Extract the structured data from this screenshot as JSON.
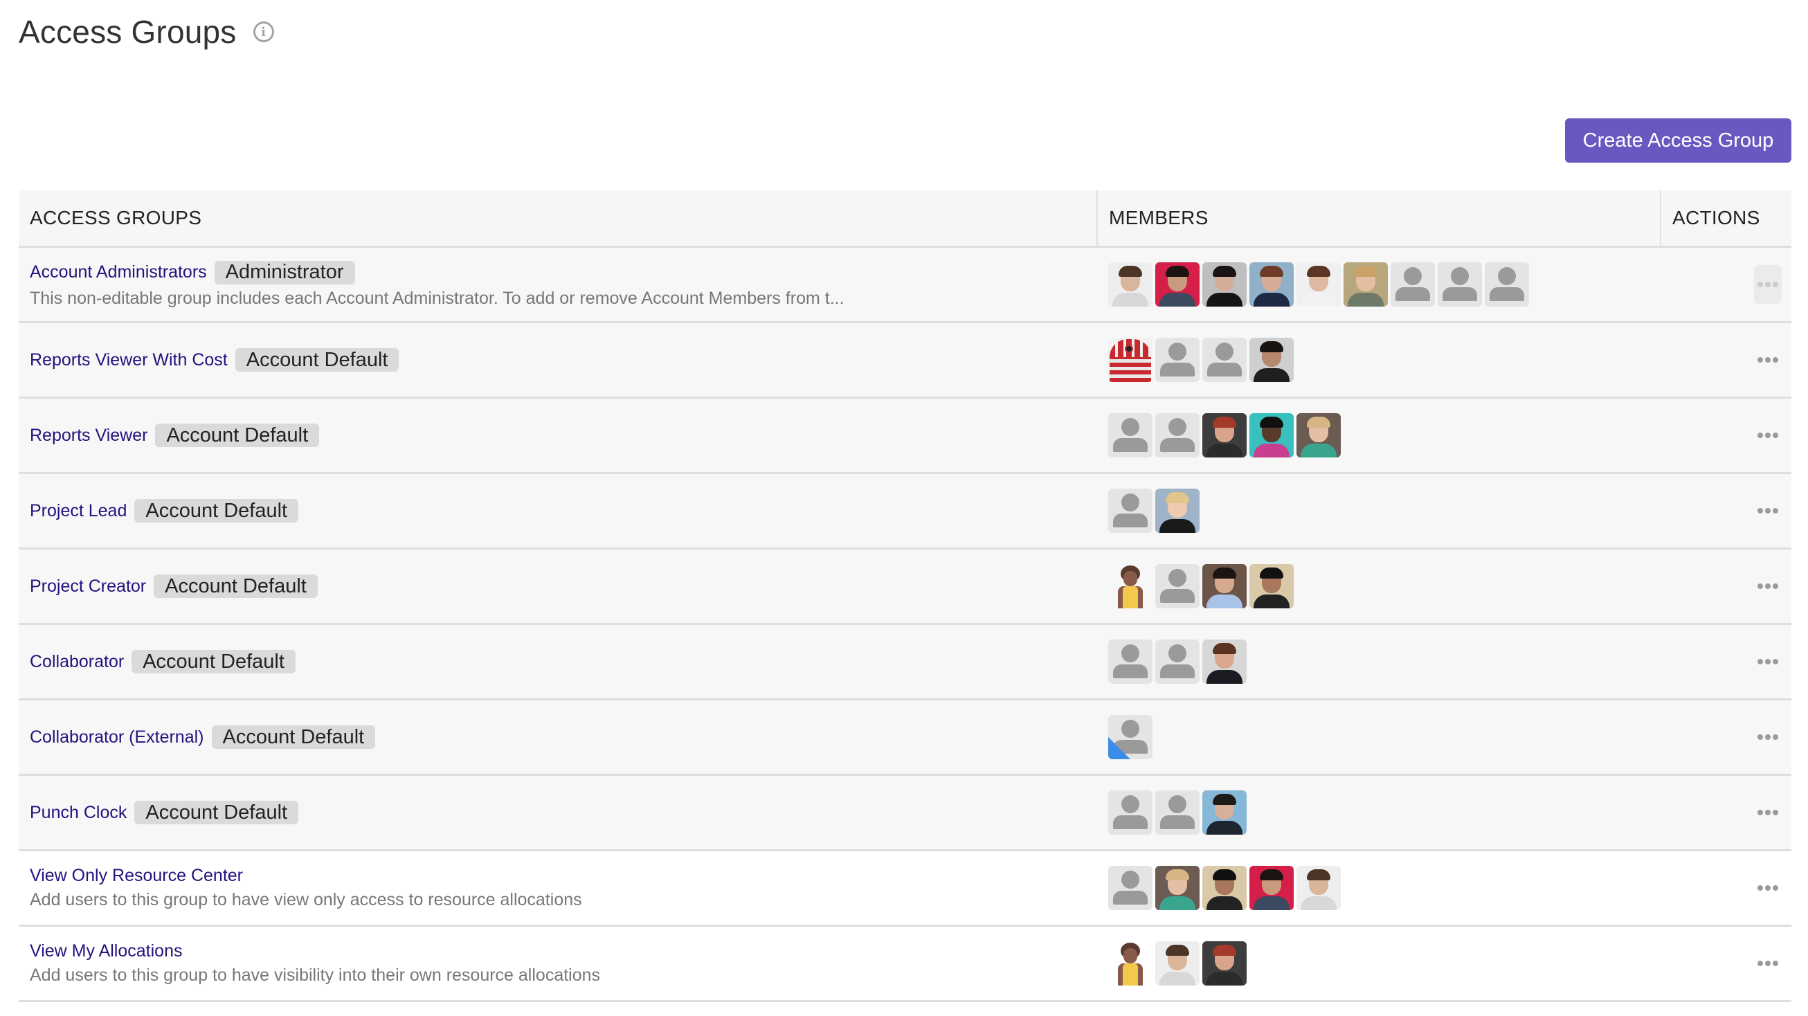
{
  "header": {
    "title": "Access Groups",
    "info_icon": "info-circle-icon"
  },
  "toolbar": {
    "create_label": "Create Access Group",
    "accent_color": "#6b57c0"
  },
  "table": {
    "columns": [
      "ACCESS GROUPS",
      "MEMBERS",
      "ACTIONS"
    ],
    "rows": [
      {
        "name": "Account Administrators",
        "badge": "Administrator",
        "description": "This non-editable group includes each Account Administrator. To add or remove Account Members from t...",
        "shaded": true,
        "actions_disabled": true,
        "members": [
          {
            "type": "photo",
            "skin": "#d9b59a",
            "hair": "#4a3526",
            "top": "#d8d8d8",
            "bg": "#eeeeee"
          },
          {
            "type": "photo",
            "skin": "#c99a7d",
            "hair": "#1d1412",
            "top": "#3b4a5e",
            "bg": "#d51e48"
          },
          {
            "type": "photo",
            "skin": "#d4ad98",
            "hair": "#1a1414",
            "top": "#151515",
            "bg": "#bfbfbf"
          },
          {
            "type": "photo",
            "skin": "#d8ab96",
            "hair": "#6e3b26",
            "top": "#1e2a44",
            "bg": "#8fb0c8"
          },
          {
            "type": "photo",
            "skin": "#e0b8a2",
            "hair": "#5b3624",
            "top": "#f2f2f2",
            "bg": "#f0f0f0"
          },
          {
            "type": "photo",
            "skin": "#e3bea0",
            "hair": "#c9a26a",
            "top": "#6d7a68",
            "bg": "#b8a77c"
          },
          {
            "type": "placeholder"
          },
          {
            "type": "placeholder"
          },
          {
            "type": "placeholder"
          }
        ]
      },
      {
        "name": "Reports Viewer With Cost",
        "badge": "Account Default",
        "description": "",
        "shaded": true,
        "actions_disabled": false,
        "members": [
          {
            "type": "robot"
          },
          {
            "type": "placeholder"
          },
          {
            "type": "placeholder"
          },
          {
            "type": "photo",
            "skin": "#b5876c",
            "hair": "#1a1410",
            "top": "#1f1f1f",
            "bg": "#cfcfcf"
          }
        ]
      },
      {
        "name": "Reports Viewer",
        "badge": "Account Default",
        "description": "",
        "shaded": true,
        "actions_disabled": false,
        "members": [
          {
            "type": "placeholder"
          },
          {
            "type": "placeholder"
          },
          {
            "type": "photo",
            "skin": "#d8a58c",
            "hair": "#a33a2a",
            "top": "#2b2b2b",
            "bg": "#3d3d3d"
          },
          {
            "type": "photo",
            "skin": "#5a3a2a",
            "hair": "#111111",
            "top": "#c93f8f",
            "bg": "#38c0c0"
          },
          {
            "type": "photo",
            "skin": "#e5bfa5",
            "hair": "#d8b585",
            "top": "#3aa58f",
            "bg": "#6b5b52"
          }
        ]
      },
      {
        "name": "Project Lead",
        "badge": "Account Default",
        "description": "",
        "shaded": true,
        "actions_disabled": false,
        "members": [
          {
            "type": "placeholder"
          },
          {
            "type": "photo",
            "skin": "#efc9b0",
            "hair": "#e2c58a",
            "top": "#1a1a1a",
            "bg": "#9fb3c9"
          }
        ]
      },
      {
        "name": "Project Creator",
        "badge": "Account Default",
        "description": "",
        "shaded": true,
        "actions_disabled": false,
        "members": [
          {
            "type": "illustration"
          },
          {
            "type": "placeholder"
          },
          {
            "type": "photo",
            "skin": "#d6a88c",
            "hair": "#1c1410",
            "top": "#a9c3e8",
            "bg": "#6b5448"
          },
          {
            "type": "photo",
            "skin": "#a9775c",
            "hair": "#111111",
            "top": "#222222",
            "bg": "#d9c9a8"
          }
        ]
      },
      {
        "name": "Collaborator",
        "badge": "Account Default",
        "description": "",
        "shaded": true,
        "actions_disabled": false,
        "members": [
          {
            "type": "placeholder"
          },
          {
            "type": "placeholder"
          },
          {
            "type": "photo",
            "skin": "#d9a78e",
            "hair": "#5a3322",
            "top": "#1b1b22",
            "bg": "#d7d7d7"
          }
        ]
      },
      {
        "name": "Collaborator (External)",
        "badge": "Account Default",
        "description": "",
        "shaded": true,
        "actions_disabled": false,
        "members": [
          {
            "type": "placeholder",
            "external": true
          }
        ]
      },
      {
        "name": "Punch Clock",
        "badge": "Account Default",
        "description": "",
        "shaded": true,
        "actions_disabled": false,
        "members": [
          {
            "type": "placeholder"
          },
          {
            "type": "placeholder"
          },
          {
            "type": "photo",
            "skin": "#d8b09a",
            "hair": "#1e1a18",
            "top": "#1c2530",
            "bg": "#86b7d6"
          }
        ]
      },
      {
        "name": "View Only Resource Center",
        "badge": "",
        "description": "Add users to this group to have view only access to resource allocations",
        "shaded": false,
        "actions_disabled": false,
        "members": [
          {
            "type": "placeholder"
          },
          {
            "type": "photo",
            "skin": "#e5bfa5",
            "hair": "#d8b585",
            "top": "#3aa58f",
            "bg": "#6b5b52"
          },
          {
            "type": "photo",
            "skin": "#a9775c",
            "hair": "#111111",
            "top": "#222222",
            "bg": "#d9c9a8"
          },
          {
            "type": "photo",
            "skin": "#c99a7d",
            "hair": "#1d1412",
            "top": "#3b4a5e",
            "bg": "#d51e48"
          },
          {
            "type": "photo",
            "skin": "#d9b59a",
            "hair": "#4a3526",
            "top": "#d8d8d8",
            "bg": "#eeeeee"
          }
        ]
      },
      {
        "name": "View My Allocations",
        "badge": "",
        "description": "Add users to this group to have visibility into their own resource allocations",
        "shaded": false,
        "actions_disabled": false,
        "members": [
          {
            "type": "illustration"
          },
          {
            "type": "photo",
            "skin": "#d9b59a",
            "hair": "#4a3526",
            "top": "#d8d8d8",
            "bg": "#eeeeee"
          },
          {
            "type": "photo",
            "skin": "#d8a58c",
            "hair": "#a33a2a",
            "top": "#2b2b2b",
            "bg": "#3d3d3d"
          }
        ]
      }
    ]
  },
  "icons": {
    "actions": "more-horizontal-icon",
    "placeholder": "user-placeholder-icon"
  }
}
